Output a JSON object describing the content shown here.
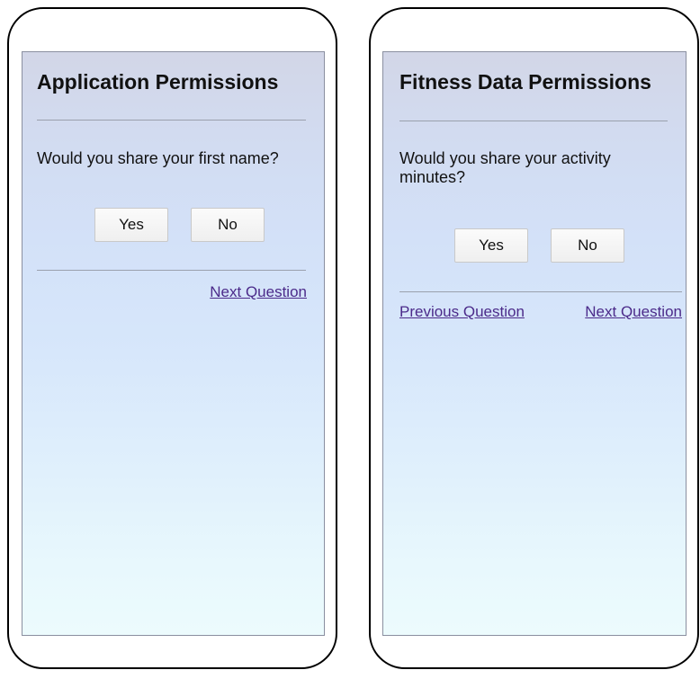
{
  "screens": [
    {
      "title": "Application Permissions",
      "question": "Would you share your first name?",
      "yes_label": "Yes",
      "no_label": "No",
      "next_label": "Next Question"
    },
    {
      "title": "Fitness Data Permissions",
      "question": "Would you share your activity minutes?",
      "yes_label": "Yes",
      "no_label": "No",
      "previous_label": "Previous Question",
      "next_label": "Next Question"
    }
  ],
  "colors": {
    "link": "#4b2a8a",
    "frame": "#000000"
  }
}
